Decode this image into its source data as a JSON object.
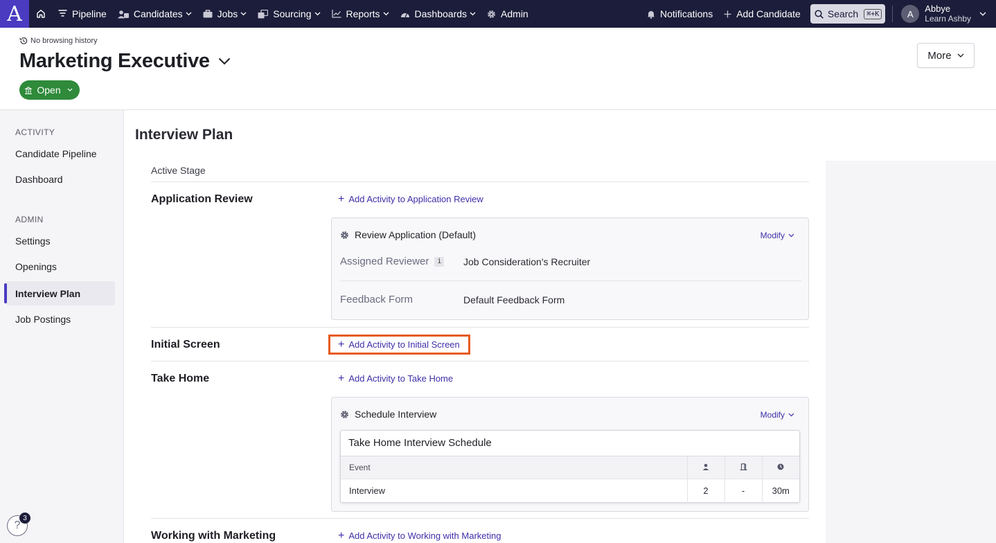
{
  "nav": {
    "logo": "A",
    "items": [
      {
        "label": "Pipeline",
        "icon": "filter-icon",
        "chevron": false
      },
      {
        "label": "Candidates",
        "icon": "people-icon",
        "chevron": true
      },
      {
        "label": "Jobs",
        "icon": "briefcase-icon",
        "chevron": true
      },
      {
        "label": "Sourcing",
        "icon": "sourcing-icon",
        "chevron": true
      },
      {
        "label": "Reports",
        "icon": "chart-icon",
        "chevron": true
      },
      {
        "label": "Dashboards",
        "icon": "gauge-icon",
        "chevron": true
      },
      {
        "label": "Admin",
        "icon": "gear-icon",
        "chevron": false
      }
    ],
    "notifications_label": "Notifications",
    "add_candidate_label": "Add Candidate",
    "search_label": "Search",
    "search_shortcut": "⌘+K",
    "user": {
      "initial": "A",
      "name": "Abbye",
      "org": "Learn Ashby"
    }
  },
  "header": {
    "history_label": "No browsing history",
    "job_title": "Marketing Executive",
    "status_label": "Open",
    "more_label": "More"
  },
  "sidebar": {
    "activity_heading": "ACTIVITY",
    "activity_items": [
      "Candidate Pipeline",
      "Dashboard"
    ],
    "admin_heading": "ADMIN",
    "admin_items": [
      "Settings",
      "Openings",
      "Interview Plan",
      "Job Postings"
    ],
    "active_item": "Interview Plan"
  },
  "main": {
    "title": "Interview Plan",
    "active_stage_label": "Active Stage",
    "stages": {
      "application_review": {
        "name": "Application Review",
        "add_link": "Add Activity to Application Review",
        "card": {
          "title": "Review Application (Default)",
          "modify_label": "Modify",
          "fields": [
            {
              "label": "Assigned Reviewer",
              "info": "i",
              "value": "Job Consideration's Recruiter"
            },
            {
              "label": "Feedback Form",
              "value": "Default Feedback Form"
            }
          ]
        }
      },
      "initial_screen": {
        "name": "Initial Screen",
        "add_link": "Add Activity to Initial Screen"
      },
      "take_home": {
        "name": "Take Home",
        "add_link": "Add Activity to Take Home",
        "card": {
          "title": "Schedule Interview",
          "modify_label": "Modify",
          "schedule": {
            "title": "Take Home Interview Schedule",
            "header": {
              "event": "Event"
            },
            "rows": [
              {
                "event": "Interview",
                "interviewers": "2",
                "room": "-",
                "duration": "30m"
              }
            ]
          }
        }
      },
      "working_with_marketing": {
        "name": "Working with Marketing",
        "add_link": "Add Activity to Working with Marketing"
      }
    }
  },
  "help": {
    "badge_count": "3",
    "icon": "?"
  },
  "colors": {
    "nav_bg": "#1c1d3a",
    "brand": "#4a3bc1",
    "link": "#3d2fa8",
    "status_green": "#2f8a3a",
    "highlight": "#e85a1e"
  }
}
